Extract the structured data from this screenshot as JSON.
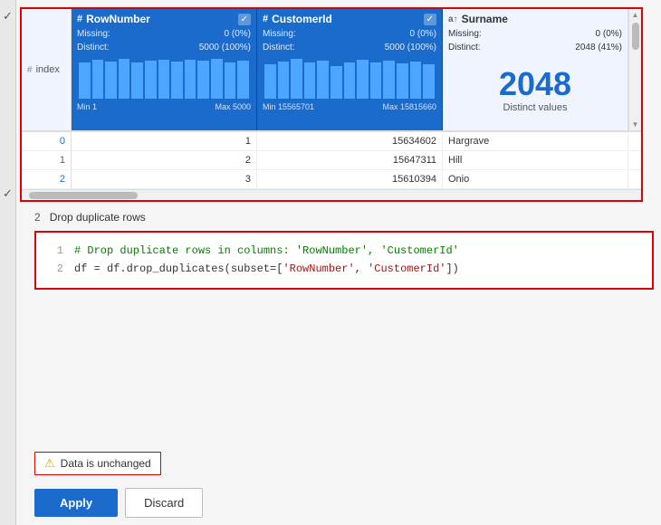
{
  "table": {
    "columns": [
      {
        "name": "index",
        "type": "index",
        "icon": "#"
      },
      {
        "id": "rownum",
        "name": "RowNumber",
        "type": "numeric",
        "icon": "#",
        "missing": "0 (0%)",
        "distinct": "5000 (100%)",
        "min": "Min 1",
        "max": "Max 5000",
        "bars": [
          85,
          90,
          88,
          92,
          86,
          89,
          91,
          87,
          90,
          88,
          92,
          86,
          89
        ]
      },
      {
        "id": "customerid",
        "name": "CustomerId",
        "type": "numeric",
        "icon": "#",
        "missing": "0 (0%)",
        "distinct": "5000 (100%)",
        "min": "Min 15565701",
        "max": "Max 15815660",
        "bars": [
          80,
          88,
          92,
          85,
          90,
          78,
          88,
          92,
          86,
          90,
          84,
          88,
          82
        ]
      },
      {
        "id": "surname",
        "name": "Surname",
        "type": "text",
        "icon": "a↑",
        "missing": "0 (0%)",
        "distinct": "2048 (41%)",
        "distinct_count": "2048",
        "distinct_label": "Distinct values"
      }
    ],
    "rows": [
      {
        "index": "0",
        "rownum": "1",
        "customerid": "15634602",
        "surname": "Hargrave"
      },
      {
        "index": "1",
        "rownum": "2",
        "customerid": "15647311",
        "surname": "Hill"
      },
      {
        "index": "2",
        "rownum": "3",
        "customerid": "15610394",
        "surname": "Onio"
      }
    ]
  },
  "step": {
    "number": "2",
    "label": "Drop duplicate rows"
  },
  "code": {
    "line1_num": "1",
    "line1_comment": "# Drop duplicate rows in columns: 'RowNumber', 'CustomerId'",
    "line2_num": "2",
    "line2_code_pre": "df = df.drop_duplicates(subset=[",
    "line2_str1": "'RowNumber'",
    "line2_sep": ", ",
    "line2_str2": "'CustomerId'",
    "line2_code_post": "])"
  },
  "status": {
    "icon": "⚠",
    "text": "Data is unchanged"
  },
  "buttons": {
    "apply": "Apply",
    "discard": "Discard"
  }
}
